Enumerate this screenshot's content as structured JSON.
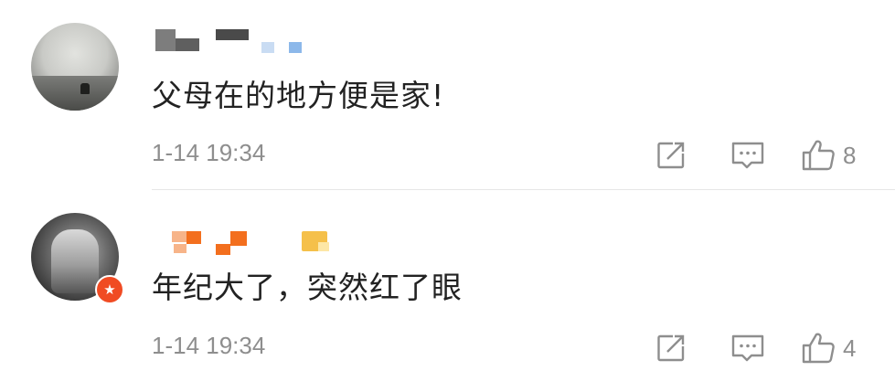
{
  "comments": [
    {
      "text": "父母在的地方便是家!",
      "time": "1-14 19:34",
      "like_count": "8",
      "actions": {
        "share_icon": "share-icon",
        "reply_icon": "comment-icon",
        "like_icon": "thumbs-up-icon"
      }
    },
    {
      "text": "年纪大了，突然红了眼",
      "time": "1-14 19:34",
      "like_count": "4",
      "badge_icon": "star-badge-icon",
      "actions": {
        "share_icon": "share-icon",
        "reply_icon": "comment-icon",
        "like_icon": "thumbs-up-icon"
      }
    }
  ],
  "colors": {
    "text_primary": "#222222",
    "text_secondary": "#8e8e8e",
    "badge": "#f04b23",
    "divider": "#e6e6e6"
  }
}
